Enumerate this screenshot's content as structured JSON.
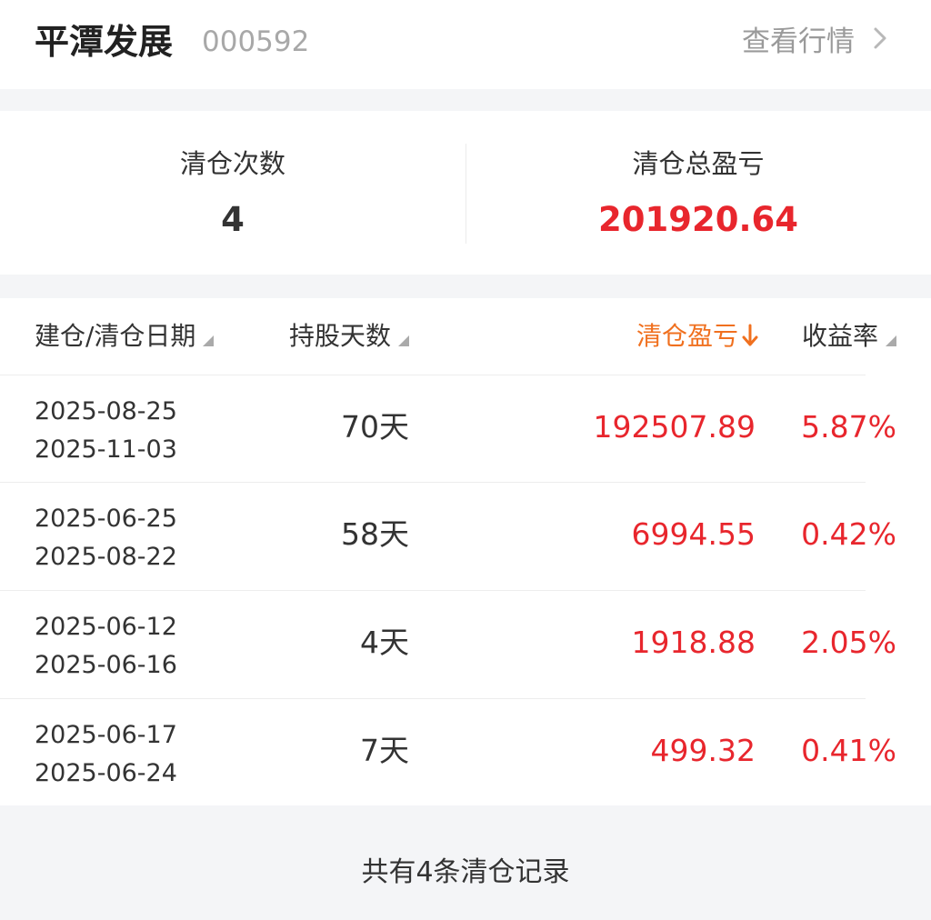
{
  "header": {
    "stock_name": "平潭发展",
    "stock_code": "000592",
    "view_quote_label": "查看行情",
    "chevron_icon": "chevron-right-icon"
  },
  "summary": {
    "count_label": "清仓次数",
    "count_value": "4",
    "total_label": "清仓总盈亏",
    "total_value": "201920.64"
  },
  "table": {
    "columns": {
      "date": "建仓/清仓日期",
      "days": "持股天数",
      "pnl": "清仓盈亏",
      "rate": "收益率"
    },
    "sort_column": "pnl",
    "sort_direction": "desc",
    "rows": [
      {
        "open_date": "2025-08-25",
        "close_date": "2025-11-03",
        "days": "70天",
        "pnl": "192507.89",
        "rate": "5.87%"
      },
      {
        "open_date": "2025-06-25",
        "close_date": "2025-08-22",
        "days": "58天",
        "pnl": "6994.55",
        "rate": "0.42%"
      },
      {
        "open_date": "2025-06-12",
        "close_date": "2025-06-16",
        "days": "4天",
        "pnl": "1918.88",
        "rate": "2.05%"
      },
      {
        "open_date": "2025-06-17",
        "close_date": "2025-06-24",
        "days": "7天",
        "pnl": "499.32",
        "rate": "0.41%"
      }
    ]
  },
  "footer": {
    "text": "共有4条清仓记录"
  },
  "colors": {
    "profit_red": "#e8262d",
    "sort_active_orange": "#f0701f"
  }
}
